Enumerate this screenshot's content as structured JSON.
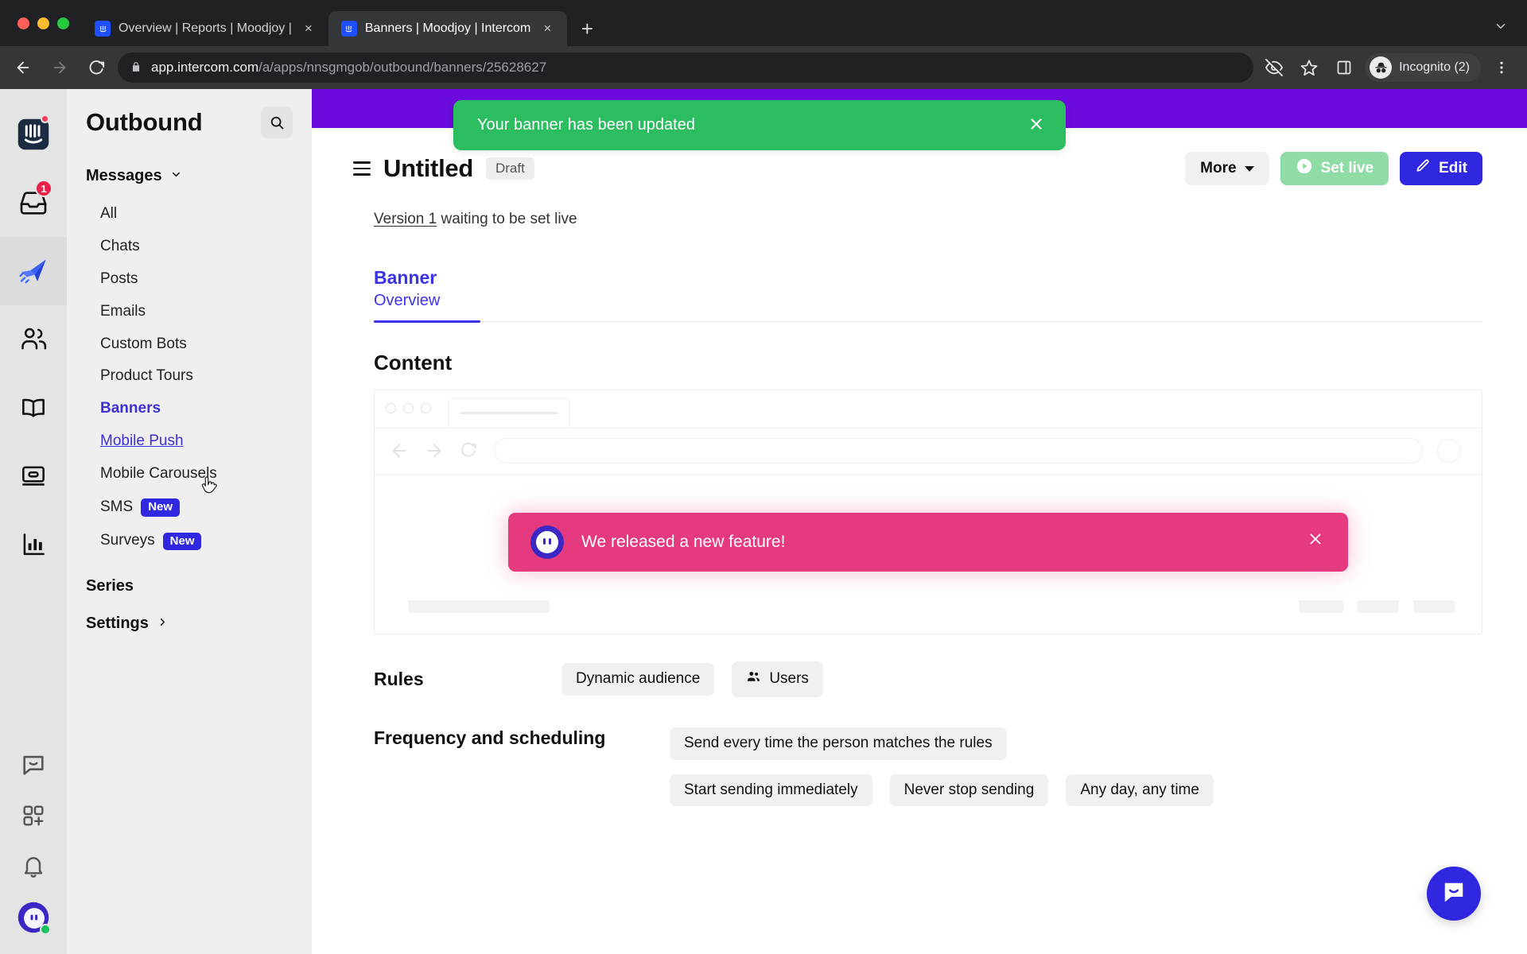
{
  "browser": {
    "tabs": [
      {
        "title": "Overview | Reports | Moodjoy |",
        "active": false,
        "favicon": "intercom-icon"
      },
      {
        "title": "Banners | Moodjoy | Intercom",
        "active": true,
        "favicon": "intercom-icon"
      }
    ],
    "new_tab_label": "+",
    "tab_list_chevron": "chevron-down-icon",
    "close_label": "×",
    "url": {
      "lock": "lock-icon",
      "domain": "app.intercom.com",
      "path": "/a/apps/nnsgmgob/outbound/banners/25628627"
    },
    "toolbar": {
      "back": "back-arrow-icon",
      "forward": "forward-arrow-icon",
      "reload": "reload-icon",
      "tracking_protection": "eye-slash-icon",
      "bookmark": "star-icon",
      "side_panel": "side-panel-icon",
      "profile_label": "Incognito (2)",
      "menu": "kebab-menu-icon"
    }
  },
  "rail": {
    "items": [
      {
        "name": "intercom-logo",
        "badge_dot": true
      },
      {
        "name": "inbox",
        "badge_count": "1"
      },
      {
        "name": "outbound",
        "selected": true
      },
      {
        "name": "contacts"
      },
      {
        "name": "articles"
      },
      {
        "name": "product-tours"
      },
      {
        "name": "reports"
      }
    ],
    "bottom": [
      {
        "name": "messenger"
      },
      {
        "name": "app-store"
      },
      {
        "name": "notifications"
      },
      {
        "name": "avatar",
        "online": true
      }
    ]
  },
  "sidebar": {
    "title": "Outbound",
    "search_icon": "search-icon",
    "group_label": "Messages",
    "group_chevron": "chevron-down-icon",
    "items": [
      {
        "label": "All",
        "state": "normal"
      },
      {
        "label": "Chats",
        "state": "normal"
      },
      {
        "label": "Posts",
        "state": "normal"
      },
      {
        "label": "Emails",
        "state": "normal"
      },
      {
        "label": "Custom Bots",
        "state": "normal"
      },
      {
        "label": "Product Tours",
        "state": "normal"
      },
      {
        "label": "Banners",
        "state": "active"
      },
      {
        "label": "Mobile Push",
        "state": "hovered"
      },
      {
        "label": "Mobile Carousels",
        "state": "normal"
      },
      {
        "label": "SMS",
        "state": "normal",
        "badge": "New"
      },
      {
        "label": "Surveys",
        "state": "normal",
        "badge": "New"
      }
    ],
    "series_label": "Series",
    "settings_label": "Settings",
    "settings_chevron": "chevron-right-icon"
  },
  "toast": {
    "message": "Your banner has been updated",
    "close_icon": "close-icon",
    "color": "#2bbd60"
  },
  "header": {
    "menu_icon": "hamburger-icon",
    "title": "Untitled",
    "status": "Draft",
    "more_label": "More",
    "more_caret": "chevron-down-icon",
    "set_live_label": "Set live",
    "set_live_icon": "play-circle-icon",
    "edit_label": "Edit",
    "edit_icon": "pencil-icon"
  },
  "main": {
    "version_link": "Version 1",
    "version_text": " waiting to be set live",
    "tab_primary": "Banner",
    "tab_secondary": "Overview",
    "content_heading": "Content",
    "preview": {
      "banner_text": "We released a new feature!",
      "banner_close_icon": "close-icon",
      "banner_color": "#e63a80",
      "avatar_icon": "intercom-face-icon"
    },
    "rules": {
      "label": "Rules",
      "chips": [
        {
          "label": "Dynamic audience",
          "icon": null
        },
        {
          "label": "Users",
          "icon": "users-icon"
        }
      ]
    },
    "frequency": {
      "label": "Frequency and scheduling",
      "chips_row1": [
        "Send every time the person matches the rules"
      ],
      "chips_row2": [
        "Start sending immediately",
        "Never stop sending",
        "Any day, any time"
      ]
    },
    "messenger_fab_icon": "messenger-icon"
  },
  "colors": {
    "accent": "#2f28e0",
    "brand_purple": "#6c0bdd",
    "success": "#2bbd60",
    "banner_pink": "#e63a80",
    "set_live_green": "#8fdca6"
  }
}
